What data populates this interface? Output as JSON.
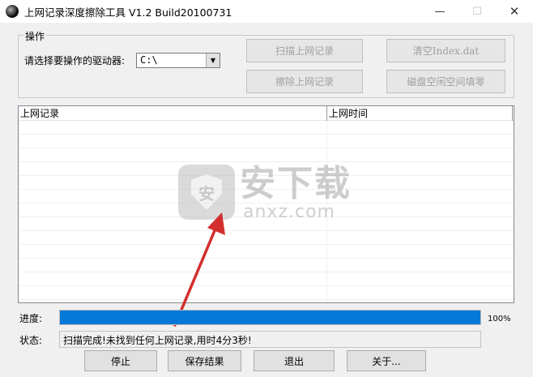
{
  "window": {
    "title": "上网记录深度擦除工具 V1.2   Build20100731",
    "minimize_glyph": "—",
    "maximize_glyph": "☐",
    "close_glyph": "✕"
  },
  "operations": {
    "legend": "操作",
    "drive_label": "请选择要操作的驱动器:",
    "drive_value": "C:\\",
    "buttons": {
      "scan": "扫描上网记录",
      "clear_index": "清空Index.dat",
      "erase": "擦除上网记录",
      "wipe_free_space": "磁盘空闲空间填零"
    }
  },
  "records_table": {
    "columns": [
      "上网记录",
      "上网时间"
    ],
    "rows": []
  },
  "watermark": {
    "shield_char": "安",
    "brand": "安下载",
    "domain": "anxz.com"
  },
  "progress": {
    "label": "进度:",
    "value": 100,
    "text": "100%",
    "color": "#0678d7"
  },
  "status": {
    "label": "状态:",
    "text": "扫描完成!未找到任何上网记录,用时4分3秒!"
  },
  "bottom_buttons": {
    "stop": "停止",
    "save": "保存结果",
    "exit": "退出",
    "about": "关于..."
  },
  "annotation": {
    "arrow_color": "#d32f2f"
  }
}
